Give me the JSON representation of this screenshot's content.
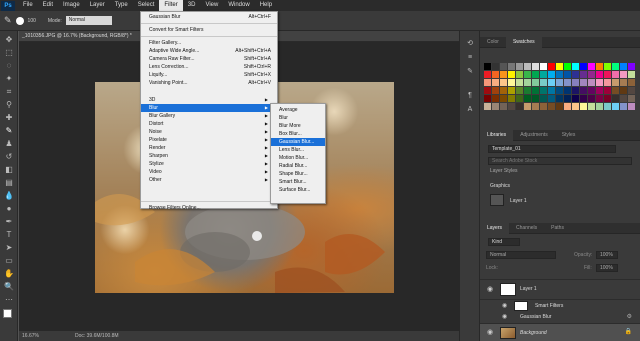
{
  "app": {
    "logo": "Ps"
  },
  "menubar": {
    "items": [
      "File",
      "Edit",
      "Image",
      "Layer",
      "Type",
      "Select",
      "Filter",
      "3D",
      "View",
      "Window",
      "Help"
    ],
    "active_index": 6
  },
  "options": {
    "size": "100",
    "mode_label": "Mode:",
    "mode_value": "Normal"
  },
  "document": {
    "tab_title": "_1010356.JPG @ 16.7% (Background, RGB/8*) *",
    "zoom": "16.67%",
    "doc_size": "Doc: 39.6M/100.8M"
  },
  "filter_menu": {
    "items": [
      {
        "label": "Gaussian Blur",
        "shortcut": "Alt+Ctrl+F"
      },
      {
        "label": "Convert for Smart Filters",
        "shortcut": ""
      },
      {
        "label": "Filter Gallery...",
        "shortcut": ""
      },
      {
        "label": "Adaptive Wide Angle...",
        "shortcut": "Alt+Shift+Ctrl+A"
      },
      {
        "label": "Camera Raw Filter...",
        "shortcut": "Shift+Ctrl+A"
      },
      {
        "label": "Lens Correction...",
        "shortcut": "Shift+Ctrl+R"
      },
      {
        "label": "Liquify...",
        "shortcut": "Shift+Ctrl+X"
      },
      {
        "label": "Vanishing Point...",
        "shortcut": "Alt+Ctrl+V"
      },
      {
        "label": "Browse Filters Online...",
        "shortcut": ""
      }
    ]
  },
  "filter_submenu": {
    "items": [
      "3D",
      "Blur",
      "Blur Gallery",
      "Distort",
      "Noise",
      "Pixelate",
      "Render",
      "Sharpen",
      "Stylize",
      "Video",
      "Other"
    ],
    "highlighted_index": 1
  },
  "blur_menu": {
    "items": [
      "Average",
      "Blur",
      "Blur More",
      "Box Blur...",
      "Gaussian Blur...",
      "Lens Blur...",
      "Motion Blur...",
      "Radial Blur...",
      "Shape Blur...",
      "Smart Blur...",
      "Surface Blur..."
    ],
    "highlighted_index": 4
  },
  "color_panel": {
    "tabs": [
      "Color",
      "Swatches"
    ],
    "active": "Swatches"
  },
  "libraries_panel": {
    "tabs": [
      "Libraries",
      "Adjustments",
      "Styles"
    ],
    "library_select": "Template_01",
    "search_placeholder": "Search Adobe Stock",
    "section_layer_styles": "Layer Styles",
    "section_graphics": "Graphics",
    "graphic_item": "Layer 1"
  },
  "layers_panel": {
    "tabs": [
      "Layers",
      "Channels",
      "Paths"
    ],
    "filter_kind": "Kind",
    "blend_mode": "Normal",
    "opacity_label": "Opacity:",
    "opacity_value": "100%",
    "lock_label": "Lock:",
    "fill_label": "Fill:",
    "fill_value": "100%",
    "layers": [
      {
        "name": "Layer 1"
      },
      {
        "name": "Smart Filters"
      },
      {
        "name": "Gaussian Blur"
      },
      {
        "name": "Background"
      }
    ]
  },
  "colors": {
    "accent": "#1a70d8",
    "ps_blue": "#31a8ff"
  }
}
